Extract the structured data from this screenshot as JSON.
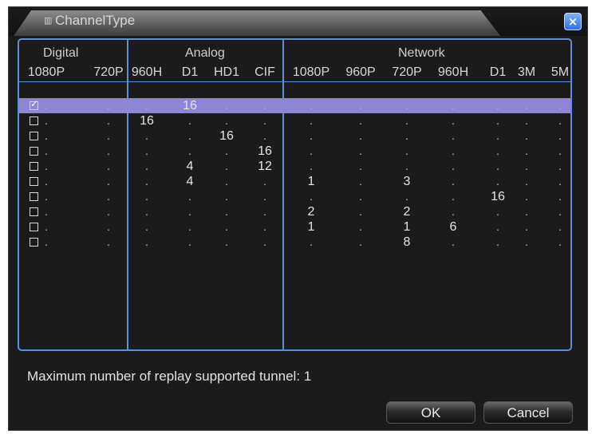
{
  "dialog": {
    "title": "ChannelType",
    "close_symbol": "×",
    "title_icon": "grip-icon"
  },
  "groups": {
    "digital": "Digital",
    "analog": "Analog",
    "network": "Network"
  },
  "columns": [
    "1080P",
    "720P",
    "960H",
    "D1",
    "HD1",
    "CIF",
    "1080P",
    "960P",
    "720P",
    "960H",
    "D1",
    "3M",
    "5M"
  ],
  "rows": [
    {
      "checked": true,
      "selected": true,
      "cells": [
        ".",
        ".",
        ".",
        "16",
        ".",
        ".",
        ".",
        ".",
        ".",
        ".",
        ".",
        ".",
        "."
      ]
    },
    {
      "checked": false,
      "selected": false,
      "cells": [
        ".",
        ".",
        "16",
        ".",
        ".",
        ".",
        ".",
        ".",
        ".",
        ".",
        ".",
        ".",
        "."
      ]
    },
    {
      "checked": false,
      "selected": false,
      "cells": [
        ".",
        ".",
        ".",
        ".",
        "16",
        ".",
        ".",
        ".",
        ".",
        ".",
        ".",
        ".",
        "."
      ]
    },
    {
      "checked": false,
      "selected": false,
      "cells": [
        ".",
        ".",
        ".",
        ".",
        ".",
        "16",
        ".",
        ".",
        ".",
        ".",
        ".",
        ".",
        "."
      ]
    },
    {
      "checked": false,
      "selected": false,
      "cells": [
        ".",
        ".",
        ".",
        "4",
        ".",
        "12",
        ".",
        ".",
        ".",
        ".",
        ".",
        ".",
        "."
      ]
    },
    {
      "checked": false,
      "selected": false,
      "cells": [
        ".",
        ".",
        ".",
        "4",
        ".",
        ".",
        "1",
        ".",
        "3",
        ".",
        ".",
        ".",
        "."
      ]
    },
    {
      "checked": false,
      "selected": false,
      "cells": [
        ".",
        ".",
        ".",
        ".",
        ".",
        ".",
        ".",
        ".",
        ".",
        ".",
        "16",
        ".",
        "."
      ]
    },
    {
      "checked": false,
      "selected": false,
      "cells": [
        ".",
        ".",
        ".",
        ".",
        ".",
        ".",
        "2",
        ".",
        "2",
        ".",
        ".",
        ".",
        "."
      ]
    },
    {
      "checked": false,
      "selected": false,
      "cells": [
        ".",
        ".",
        ".",
        ".",
        ".",
        ".",
        "1",
        ".",
        "1",
        "6",
        ".",
        ".",
        "."
      ]
    },
    {
      "checked": false,
      "selected": false,
      "cells": [
        ".",
        ".",
        ".",
        ".",
        ".",
        ".",
        ".",
        ".",
        "8",
        ".",
        ".",
        ".",
        "."
      ]
    }
  ],
  "footer": {
    "max_replay": "Maximum number of replay supported tunnel: 1",
    "ok_label": "OK",
    "cancel_label": "Cancel"
  },
  "colors": {
    "accent_border": "#5d8fd8",
    "selected_row": "#8d86d6",
    "background": "#1b1b1b"
  }
}
